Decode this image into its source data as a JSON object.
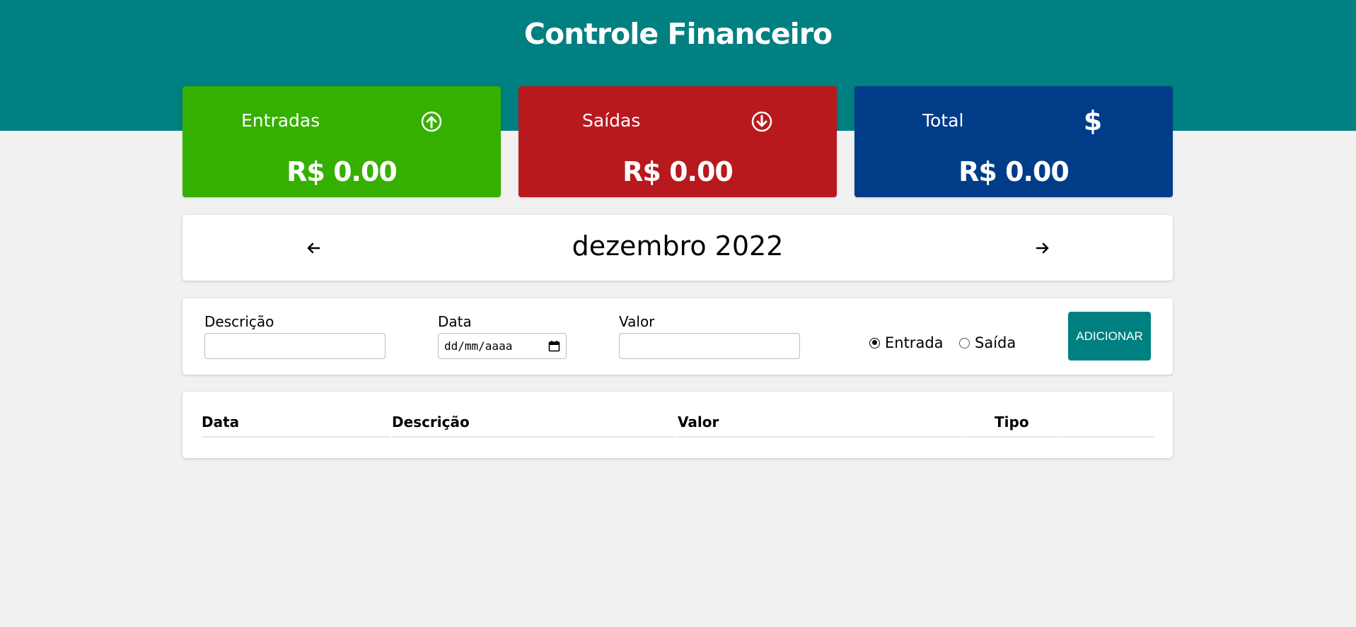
{
  "header": {
    "title": "Controle Financeiro",
    "background": "#008080"
  },
  "summary": {
    "entradas": {
      "label": "Entradas",
      "value": "R$ 0.00",
      "icon": "arrow-up-circle-icon",
      "color": "#36b000"
    },
    "saidas": {
      "label": "Saídas",
      "value": "R$ 0.00",
      "icon": "arrow-down-circle-icon",
      "color": "#b8191d"
    },
    "total": {
      "label": "Total",
      "value": "R$ 0.00",
      "icon": "dollar-icon",
      "symbol": "$",
      "color": "#003c88"
    }
  },
  "month_nav": {
    "label": "dezembro 2022",
    "prev_icon": "arrow-left-icon",
    "next_icon": "arrow-right-icon"
  },
  "form": {
    "descricao_label": "Descrição",
    "descricao_value": "",
    "data_label": "Data",
    "data_placeholder": "dd/mm/aaaa",
    "valor_label": "Valor",
    "valor_value": "",
    "radio_entrada": "Entrada",
    "radio_saida": "Saída",
    "selected_type": "Entrada",
    "add_button": "ADICIONAR"
  },
  "table": {
    "headers": [
      "Data",
      "Descrição",
      "Valor",
      "Tipo"
    ],
    "rows": []
  }
}
